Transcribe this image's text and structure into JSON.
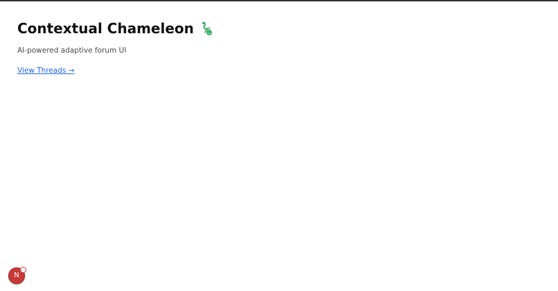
{
  "page": {
    "title": "Contextual Chameleon",
    "title_icon": "chameleon-emoji",
    "subtitle": "AI-powered adaptive forum UI",
    "link_label": "View Threads →"
  },
  "dev_indicator": {
    "letter": "N",
    "icon": "nextjs-dev-indicator",
    "color": "#c83a3a",
    "has_notification_badge": true
  },
  "colors": {
    "link": "#2563eb",
    "title": "#111111",
    "subtitle": "#4a4a4a",
    "icon_green": "#3fb36b"
  }
}
